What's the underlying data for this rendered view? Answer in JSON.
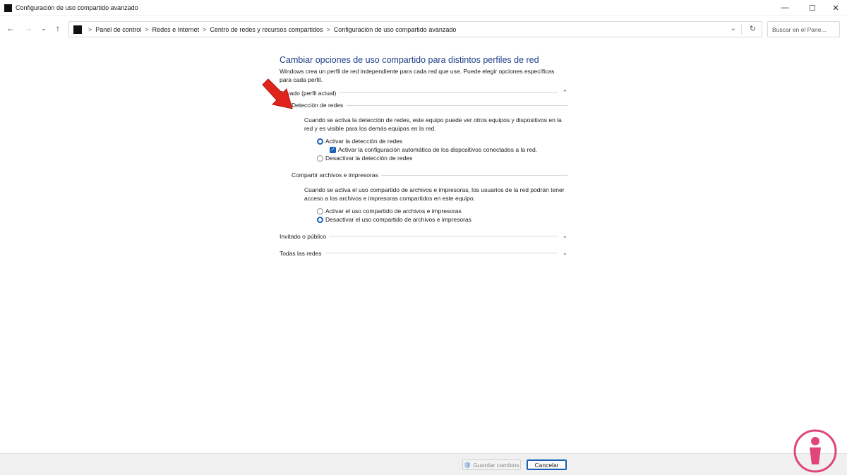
{
  "window": {
    "title": "Configuración de uso compartido avanzado",
    "minimize_glyph": "—",
    "maximize_glyph": "☐",
    "close_glyph": "✕"
  },
  "navigation": {
    "back_glyph": "←",
    "forward_glyph": "→",
    "recent_glyph": "⌄",
    "up_glyph": "↑",
    "breadcrumb": [
      "Panel de control",
      "Redes e Internet",
      "Centro de redes y recursos compartidos",
      "Configuración de uso compartido avanzado"
    ],
    "separator": ">",
    "dropdown_glyph": "⌄",
    "refresh_glyph": "↻",
    "search_placeholder": "Buscar en el Pane..."
  },
  "main": {
    "title": "Cambiar opciones de uso compartido para distintos perfiles de red",
    "intro": "Windows crea un perfil de red independiente para cada red que use. Puede elegir opciones específicas para cada perfil.",
    "private_profile": {
      "label": "Privado (perfil actual)",
      "chevron": "⌃",
      "network_discovery": {
        "label": "Detección de redes",
        "description": "Cuando se activa la detección de redes, este equipo puede ver otros equipos y dispositivos en la red y es visible para los demás equipos en la red.",
        "option_on": "Activar la detección de redes",
        "option_auto": "Activar la configuración automática de los dispositivos conectados a la red.",
        "option_off": "Desactivar la detección de redes",
        "selected": "on",
        "auto_checked": true
      },
      "file_sharing": {
        "label": "Compartir archivos e impresoras",
        "description": "Cuando se activa el uso compartido de archivos e impresoras, los usuarios de la red podrán tener acceso a los archivos e impresoras compartidos en este equipo.",
        "option_on": "Activar el uso compartido de archivos e impresoras",
        "option_off": "Desactivar el uso compartido de archivos e impresoras",
        "selected": "off"
      }
    },
    "guest_profile": {
      "label": "Invitado o público",
      "chevron": "⌄"
    },
    "all_networks": {
      "label": "Todas las redes",
      "chevron": "⌄"
    }
  },
  "footer": {
    "save_label": "Guardar cambios",
    "cancel_label": "Cancelar"
  },
  "colors": {
    "title_blue": "#1e3f8a",
    "accent": "#1a5fb4",
    "arrow_red": "#e0241b",
    "logo_pink": "#e0457b"
  }
}
